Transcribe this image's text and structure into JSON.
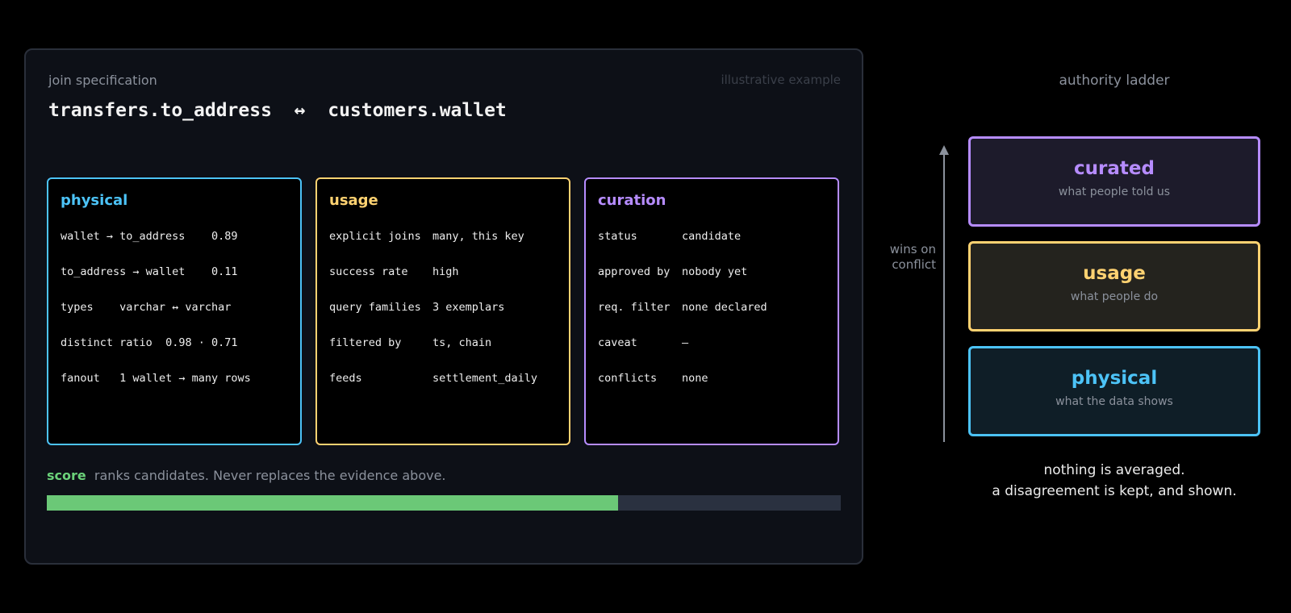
{
  "spec": {
    "label": "join specification",
    "note": "illustrative example",
    "left_key": "transfers.to_address",
    "arrow": "↔",
    "right_key": "customers.wallet"
  },
  "panels": {
    "physical": {
      "title": "physical",
      "rows": [
        {
          "k": "wallet → to_address",
          "v": "0.89"
        },
        {
          "k": "to_address → wallet",
          "v": "0.11"
        },
        {
          "k": "types",
          "v": "varchar ↔ varchar"
        },
        {
          "k": "distinct ratio",
          "v": "0.98 · 0.71"
        },
        {
          "k": "fanout",
          "v": "1 wallet → many rows"
        }
      ]
    },
    "usage": {
      "title": "usage",
      "rows": [
        {
          "k": "explicit joins",
          "v": "many, this key"
        },
        {
          "k": "success rate",
          "v": "high"
        },
        {
          "k": "query families",
          "v": "3 exemplars"
        },
        {
          "k": "filtered by",
          "v": "ts, chain"
        },
        {
          "k": "feeds",
          "v": "settlement_daily"
        }
      ]
    },
    "curation": {
      "title": "curation",
      "rows": [
        {
          "k": "status",
          "v": "candidate"
        },
        {
          "k": "approved by",
          "v": "nobody yet"
        },
        {
          "k": "req. filter",
          "v": "none declared"
        },
        {
          "k": "caveat",
          "v": "—"
        },
        {
          "k": "conflicts",
          "v": "none"
        }
      ]
    }
  },
  "score": {
    "word": "score",
    "text": "ranks candidates. Never replaces the evidence above.",
    "fill_fraction": 0.72,
    "fill_color": "#6bc877",
    "track_color": "#2a3140"
  },
  "ladder": {
    "title": "authority ladder",
    "wins_line1": "wins on",
    "wins_line2": "conflict",
    "tiers": {
      "curated": {
        "name": "curated",
        "desc": "what people told us",
        "color": "#b68cff"
      },
      "usage": {
        "name": "usage",
        "desc": "what people do",
        "color": "#ffd271"
      },
      "physical": {
        "name": "physical",
        "desc": "what the data shows",
        "color": "#4cc3f7"
      }
    },
    "closing_line1": "nothing is averaged.",
    "closing_line2": "a disagreement is kept, and shown."
  }
}
